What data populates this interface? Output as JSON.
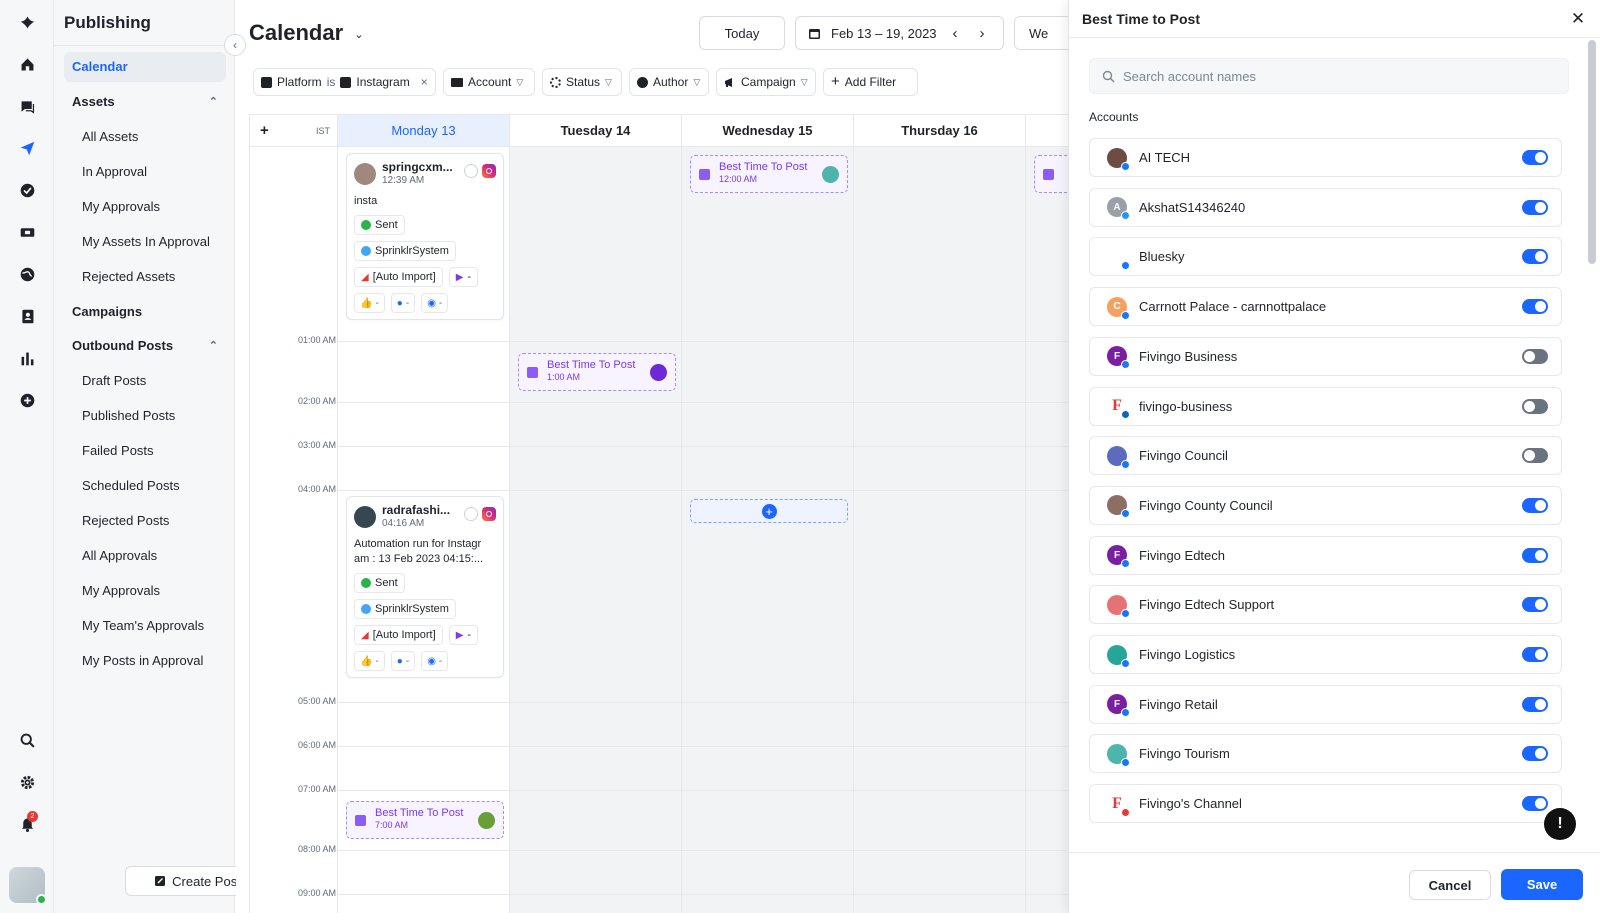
{
  "sidebar": {
    "title": "Publishing",
    "items": [
      {
        "label": "Calendar",
        "kind": "section",
        "active": true
      },
      {
        "label": "Assets",
        "kind": "section",
        "expandable": true
      },
      {
        "label": "All Assets",
        "kind": "child"
      },
      {
        "label": "In Approval",
        "kind": "child"
      },
      {
        "label": "My Approvals",
        "kind": "child"
      },
      {
        "label": "My Assets In Approval",
        "kind": "child"
      },
      {
        "label": "Rejected Assets",
        "kind": "child"
      },
      {
        "label": "Campaigns",
        "kind": "section"
      },
      {
        "label": "Outbound Posts",
        "kind": "section",
        "expandable": true
      },
      {
        "label": "Draft Posts",
        "kind": "child"
      },
      {
        "label": "Published Posts",
        "kind": "child"
      },
      {
        "label": "Failed Posts",
        "kind": "child"
      },
      {
        "label": "Scheduled Posts",
        "kind": "child"
      },
      {
        "label": "Rejected Posts",
        "kind": "child"
      },
      {
        "label": "All Approvals",
        "kind": "child"
      },
      {
        "label": "My Approvals",
        "kind": "child"
      },
      {
        "label": "My Team's Approvals",
        "kind": "child"
      },
      {
        "label": "My Posts in Approval",
        "kind": "child"
      }
    ],
    "create_post": "Create Post"
  },
  "rail": {
    "icons": [
      "logo-icon",
      "home-icon",
      "chat-icon",
      "send-icon",
      "check-circle-icon",
      "ticket-icon",
      "globe-icon",
      "contacts-icon",
      "bar-chart-icon",
      "plus-circle-icon",
      "search-icon",
      "gear-icon",
      "bell-icon"
    ],
    "notification_count": "2"
  },
  "header": {
    "title": "Calendar",
    "today": "Today",
    "date_range": "Feb 13 – 19, 2023",
    "view_label": "We"
  },
  "filters": {
    "platform_key": "Platform",
    "platform_op": "is",
    "platform_value": "Instagram",
    "account": "Account",
    "status": "Status",
    "author": "Author",
    "campaign": "Campaign",
    "add_filter": "Add Filter"
  },
  "calendar": {
    "timezone": "IST",
    "days": [
      "Monday 13",
      "Tuesday 14",
      "Wednesday 15",
      "Thursday 16"
    ],
    "times": [
      "01:00 AM",
      "02:00 AM",
      "03:00 AM",
      "04:00 AM",
      "05:00 AM",
      "06:00 AM",
      "07:00 AM",
      "08:00 AM",
      "09:00 AM"
    ],
    "posts": [
      {
        "name": "springcxm...",
        "time": "12:39 AM",
        "text": "insta",
        "status": "Sent",
        "author": "SprinklrSystem",
        "source": "[Auto Import]",
        "tag": "-",
        "likes": "-",
        "comments": "-",
        "views": "-"
      },
      {
        "name": "radrafashi...",
        "time": "04:16 AM",
        "text": "Automation run for Instagr am : 13 Feb 2023 04:15:...",
        "status": "Sent",
        "author": "SprinklrSystem",
        "source": "[Auto Import]",
        "tag": "-",
        "likes": "-",
        "comments": "-",
        "views": "-"
      }
    ],
    "best_time": [
      {
        "label": "Best Time To Post",
        "time": "12:00 AM",
        "day": "Wednesday 15"
      },
      {
        "label": "Best Time To Post",
        "time": "1:00 AM",
        "day": "Tuesday 14"
      },
      {
        "label": "Best Time To Post",
        "time": "7:00 AM",
        "day": "Monday 13"
      }
    ]
  },
  "panel": {
    "title": "Best Time to Post",
    "search_placeholder": "Search account names",
    "accounts_label": "Accounts",
    "accounts": [
      {
        "name": "AI TECH",
        "on": true,
        "avatar_color": "#6d4c41",
        "badge_color": "#1877f2"
      },
      {
        "name": "AkshatS14346240",
        "on": true,
        "avatar_color": "#9aa0a6",
        "initial": "A",
        "badge_color": "#1d9bf0"
      },
      {
        "name": "Bluesky",
        "on": true,
        "avatar_color": "#ffffff",
        "badge_color": "#1877f2"
      },
      {
        "name": "Carrnott Palace - carnnottpalace",
        "on": true,
        "avatar_color": "#f4a261",
        "initial": "C",
        "badge_color": "#1877f2"
      },
      {
        "name": "Fivingo Business",
        "on": false,
        "avatar_color": "#7b1fa2",
        "initial": "F",
        "badge_color": "#1877f2"
      },
      {
        "name": "fivingo-business",
        "on": false,
        "avatar_color": "#ffffff",
        "initial": "F",
        "badge_color": "#0a66c2"
      },
      {
        "name": "Fivingo Council",
        "on": false,
        "avatar_color": "#5c6bc0",
        "badge_color": "#1877f2"
      },
      {
        "name": "Fivingo County Council",
        "on": true,
        "avatar_color": "#8d6e63",
        "badge_color": "#1877f2"
      },
      {
        "name": "Fivingo Edtech",
        "on": true,
        "avatar_color": "#7b1fa2",
        "initial": "F",
        "badge_color": "#1877f2"
      },
      {
        "name": "Fivingo Edtech Support",
        "on": true,
        "avatar_color": "#e57373",
        "badge_color": "#1877f2"
      },
      {
        "name": "Fivingo Logistics",
        "on": true,
        "avatar_color": "#26a69a",
        "badge_color": "#1877f2"
      },
      {
        "name": "Fivingo Retail",
        "on": true,
        "avatar_color": "#7b1fa2",
        "initial": "F",
        "badge_color": "#1877f2"
      },
      {
        "name": "Fivingo Tourism",
        "on": true,
        "avatar_color": "#4db6ac",
        "badge_color": "#1877f2"
      },
      {
        "name": "Fivingo's Channel",
        "on": true,
        "avatar_color": "#ffffff",
        "initial": "F",
        "badge_color": "#e53935"
      }
    ],
    "cancel": "Cancel",
    "save": "Save",
    "alert_glyph": "!"
  },
  "colors": {
    "accent": "#1a66ff",
    "best_time": "#7c3aed",
    "toggle_off": "#6b7280"
  }
}
